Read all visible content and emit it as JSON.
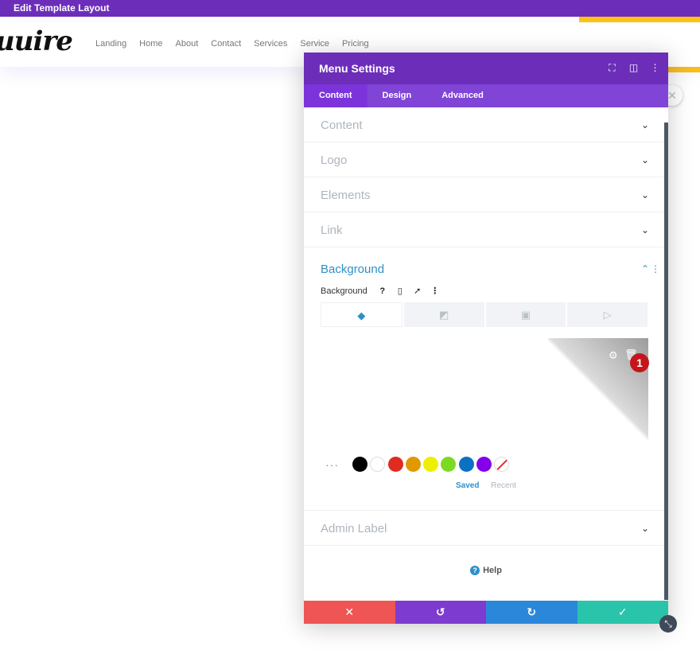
{
  "topbar": {
    "title": "Edit Template Layout"
  },
  "site": {
    "logo": "uuire",
    "nav": [
      "Landing",
      "Home",
      "About",
      "Contact",
      "Services",
      "Service",
      "Pricing"
    ]
  },
  "modal": {
    "title": "Menu Settings",
    "tabs": [
      "Content",
      "Design",
      "Advanced"
    ],
    "sections": [
      "Content",
      "Logo",
      "Elements",
      "Link"
    ],
    "background": {
      "title": "Background",
      "field_label": "Background",
      "palette": {
        "colors": [
          "#000000",
          "#ffffff",
          "#e02b20",
          "#e09900",
          "#edf000",
          "#7cda24",
          "#0c71c3",
          "#8300e9"
        ],
        "saved_label": "Saved",
        "recent_label": "Recent"
      },
      "step_badge": "1"
    },
    "admin_label": "Admin Label",
    "help_label": "Help"
  },
  "icons": {
    "chevron_down": "⌄",
    "accent": "#6c2eb9"
  }
}
